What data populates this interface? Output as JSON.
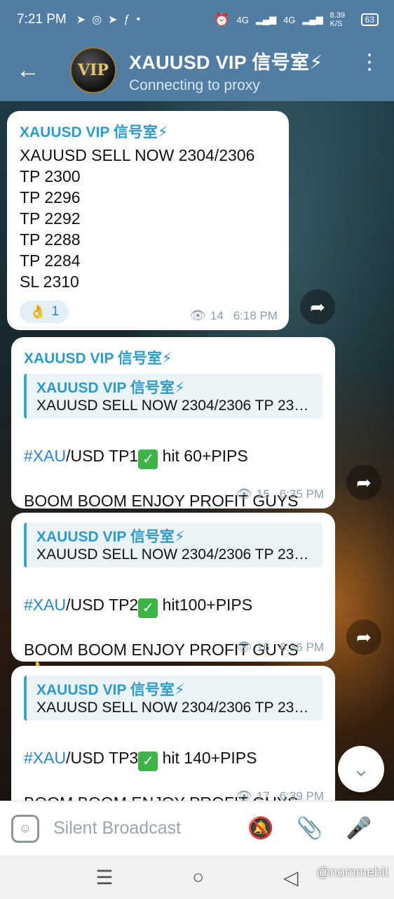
{
  "status_bar": {
    "time": "7:21 PM",
    "network1": "4G",
    "network2": "4G",
    "speed": "8.39 K/S",
    "battery": "63"
  },
  "header": {
    "title": "XAUUSD VIP 信号室⚡",
    "subtitle": "Connecting to proxy",
    "avatar_text": "VIP"
  },
  "messages": [
    {
      "sender": "XAUUSD VIP 信号室⚡",
      "text": "XAUUSD SELL NOW 2304/2306\nTP 2300\nTP 2296\nTP 2292\nTP 2288\nTP 2284\nSL 2310",
      "reaction_emoji": "👌",
      "reaction_count": "1",
      "views": "14",
      "time": "6:18 PM"
    },
    {
      "sender": "XAUUSD VIP 信号室⚡",
      "reply_sender": "XAUUSD VIP 信号室⚡",
      "reply_text": "XAUUSD SELL NOW 2304/2306 TP 2300 TP 2296",
      "hashtag": "#XAU",
      "line_pre": "/USD TP1",
      "line_post": " hit 60+PIPS",
      "line2": "BOOM BOOM ENJOY PROFIT GUYS",
      "emoji": "👍",
      "views": "15",
      "time": "6:35 PM"
    },
    {
      "reply_sender": "XAUUSD VIP 信号室⚡",
      "reply_text": "XAUUSD SELL NOW 2304/2306 TP 2300 TP 2296",
      "hashtag": "#XAU",
      "line_pre": "/USD TP2",
      "line_post": " hit100+PIPS",
      "line2": "BOOM BOOM ENJOY PROFIT GUYS",
      "emoji": "👍",
      "views": "16",
      "time": "6:36 PM"
    },
    {
      "reply_sender": "XAUUSD VIP 信号室⚡",
      "reply_text": "XAUUSD SELL NOW 2304/2306 TP 2300 TP 2296",
      "hashtag": "#XAU",
      "line_pre": "/USD TP3",
      "line_post": " hit 140+PIPS",
      "line2": "BOOM BOOM ENJOY PROFIT GUYS",
      "emoji": "👍",
      "views": "17",
      "time": "6:39 PM"
    }
  ],
  "input": {
    "placeholder": "Silent Broadcast"
  },
  "watermark": "@nommebit",
  "colors": {
    "header": "#517da2",
    "accent": "#2e9bc7",
    "hashtag": "#2e86c1"
  }
}
